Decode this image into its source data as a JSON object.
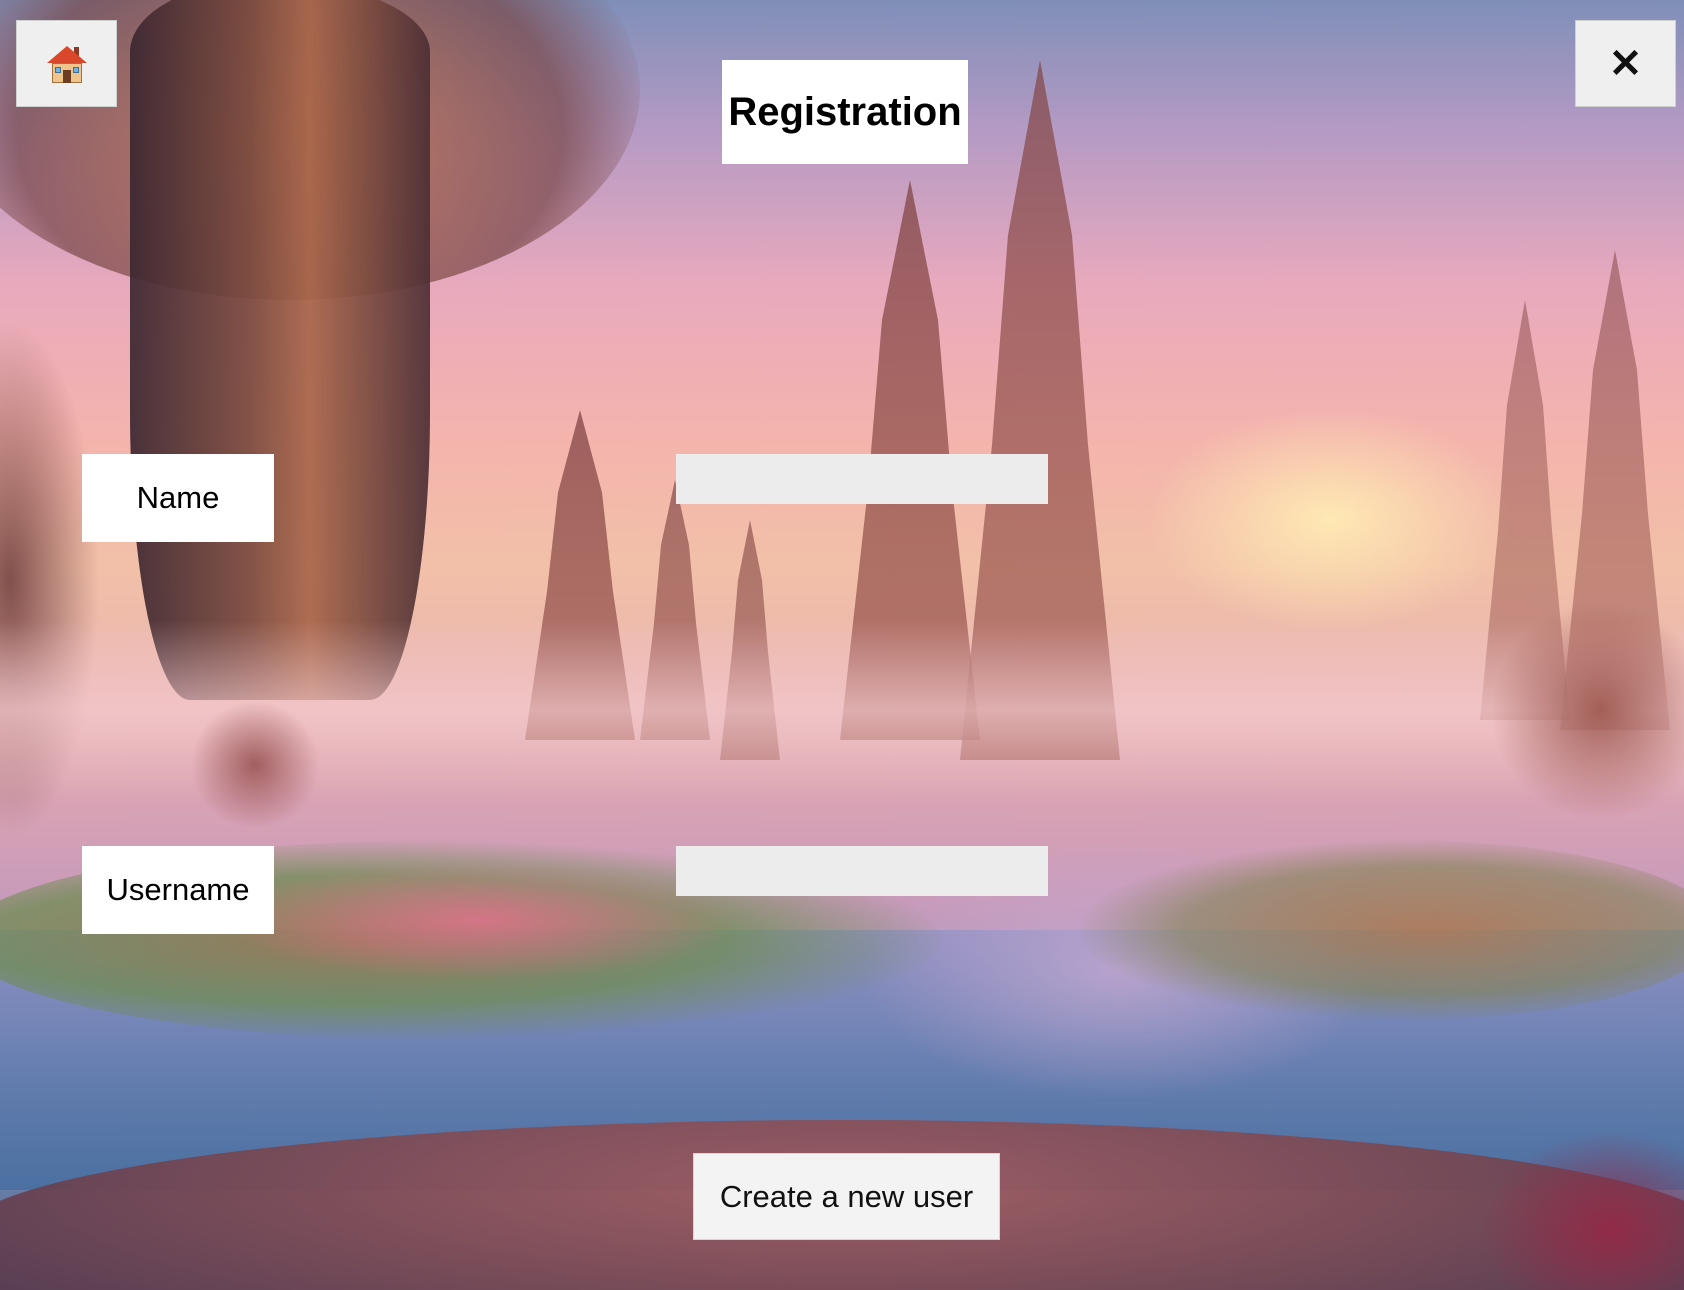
{
  "window": {
    "title": "Registration"
  },
  "toolbar": {
    "home_icon": "house-icon",
    "close_icon": "close-icon",
    "close_glyph": "✕"
  },
  "form": {
    "name_label": "Name",
    "name_value": "",
    "username_label": "Username",
    "username_value": "",
    "submit_label": "Create a new user"
  },
  "colors": {
    "panel_background": "#ffffff",
    "button_background": "#efefef",
    "input_background": "#ececec"
  }
}
